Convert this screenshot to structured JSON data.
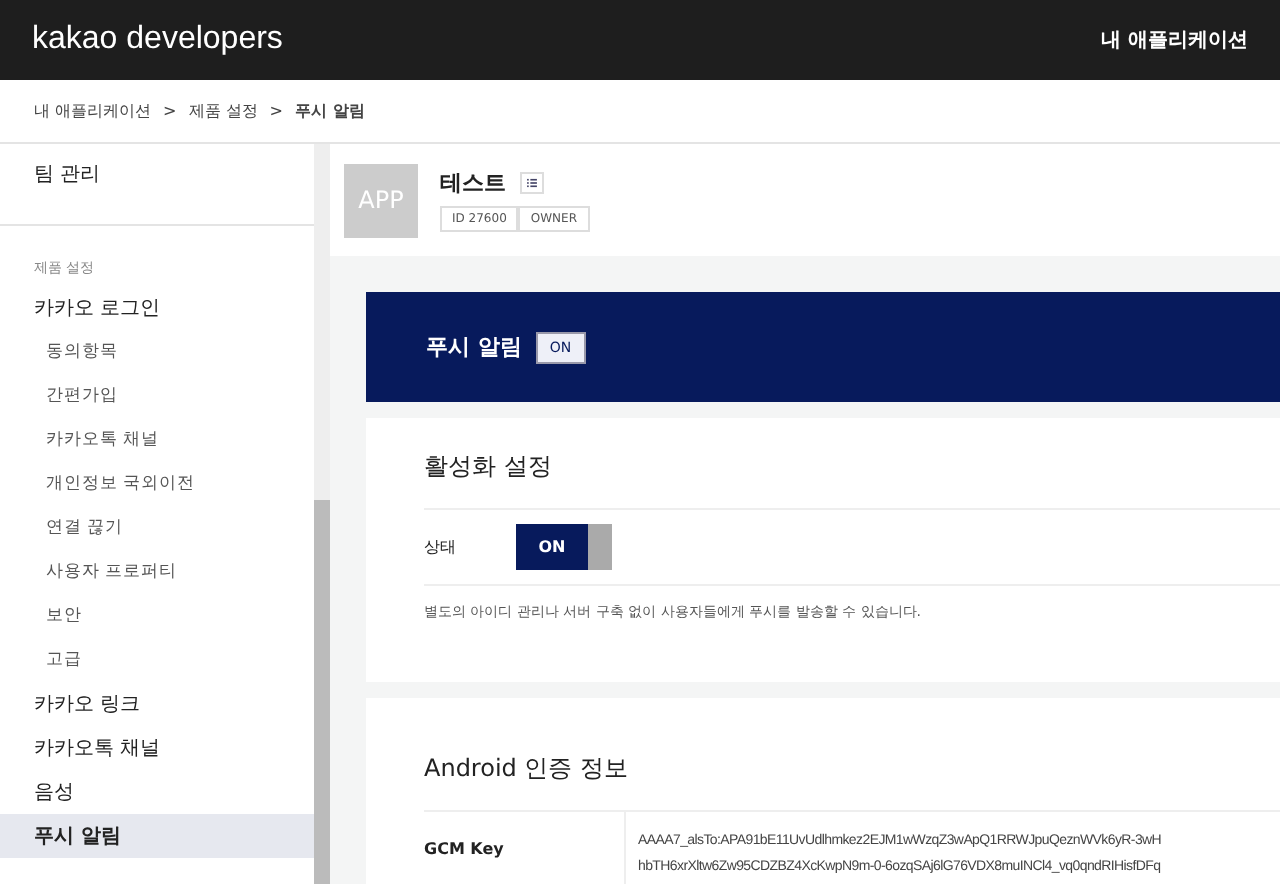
{
  "header": {
    "logo": "kakao developers",
    "menu": "내 애플리케이션"
  },
  "breadcrumb": [
    "내 애플리케이션",
    "제품 설정",
    "푸시 알림"
  ],
  "breadcrumb_separator": ">",
  "sidebar": {
    "top_items": [
      {
        "label": "팀 관리",
        "selected": false
      }
    ],
    "section_label": "제품 설정",
    "items": [
      {
        "label": "카카오 로그인",
        "selected": false,
        "children": [
          {
            "label": "동의항목",
            "selected": false
          },
          {
            "label": "간편가입",
            "selected": false
          },
          {
            "label": "카카오톡 채널",
            "selected": false
          },
          {
            "label": "개인정보 국외이전",
            "selected": false
          },
          {
            "label": "연결 끊기",
            "selected": false
          },
          {
            "label": "사용자 프로퍼티",
            "selected": false
          },
          {
            "label": "보안",
            "selected": false
          },
          {
            "label": "고급",
            "selected": false
          }
        ]
      },
      {
        "label": "카카오 링크",
        "selected": false
      },
      {
        "label": "카카오톡 채널",
        "selected": false
      },
      {
        "label": "음성",
        "selected": false
      },
      {
        "label": "푸시 알림",
        "selected": true
      }
    ]
  },
  "app": {
    "icon_text": "APP",
    "name": "테스트",
    "tags": [
      "ID 27600",
      "OWNER"
    ]
  },
  "banner": {
    "title": "푸시 알림",
    "badge": "ON"
  },
  "activation": {
    "title": "활성화 설정",
    "status_label": "상태",
    "toggle": {
      "label": "ON",
      "on": true
    },
    "description": "별도의 아이디 관리나 서버 구축 없이 사용자들에게 푸시를 발송할 수 있습니다."
  },
  "android": {
    "title": "Android 인증 정보",
    "rows": [
      {
        "label": "GCM Key",
        "lines": [
          "AAAA7_alsTo:APA91bE11UvUdlhmkez2EJM1wWzqZ3wApQ1RRWJpuQeznWVk6yR-3wH",
          "hbTH6xrXltw6Zw95CDZBZ4XcKwpN9m-0-6ozqSAj6lG76VDX8muINCl4_vq0qndRIHisfDFq"
        ]
      }
    ]
  }
}
